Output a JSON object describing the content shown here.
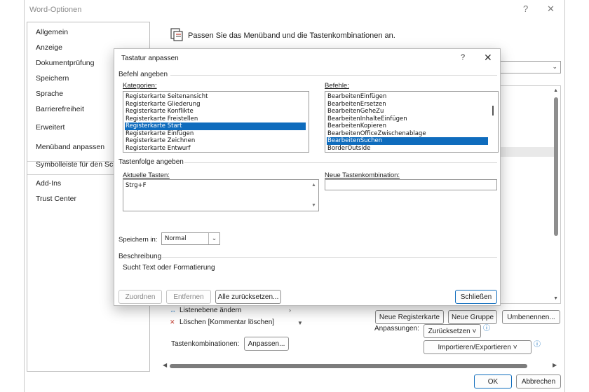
{
  "window": {
    "title": "Word-Optionen",
    "help_glyph": "?",
    "close_glyph": "✕"
  },
  "nav": {
    "items": [
      "Allgemein",
      "Anzeige",
      "Dokumentprüfung",
      "Speichern",
      "Sprache",
      "Barrierefreiheit",
      "Erweitert",
      "Menüband anpassen",
      "Symbolleiste für den Schn",
      "Add-Ins",
      "Trust Center"
    ]
  },
  "main": {
    "header": "Passen Sie das Menüband und die Tastenkombinationen an.",
    "list_items": [
      {
        "icon": "↔",
        "label": "Listenebene ändern"
      },
      {
        "icon": "✕",
        "label": "Löschen [Kommentar löschen]"
      }
    ],
    "new_tab_label": "Neue Registerkarte",
    "new_group_label": "Neue Gruppe",
    "rename_label": "Umbenennen...",
    "customizations_label": "Anpassungen:",
    "reset_label": "Zurücksetzen ˅",
    "import_export_label": "Importieren/Exportieren ˅",
    "shortcuts_label": "Tastenkombinationen:",
    "customize_label": "Anpassen...",
    "ok_label": "OK",
    "cancel_label": "Abbrechen"
  },
  "dialog": {
    "title": "Tastatur anpassen",
    "help_glyph": "?",
    "close_glyph": "✕",
    "section_commands": "Befehl angeben",
    "categories_label": "Kategorien:",
    "categories": [
      "Registerkarte Seitenansicht",
      "Registerkarte Gliederung",
      "Registerkarte Konflikte",
      "Registerkarte Freistellen",
      "Registerkarte Start",
      "Registerkarte Einfügen",
      "Registerkarte Zeichnen",
      "Registerkarte Entwurf"
    ],
    "categories_selected": 4,
    "commands_label": "Befehle:",
    "commands": [
      "BearbeitenEinfügen",
      "BearbeitenErsetzen",
      "BearbeitenGeheZu",
      "BearbeitenInhalteEinfügen",
      "BearbeitenKopieren",
      "BearbeitenOfficeZwischenablage",
      "BearbeitenSuchen",
      "BorderOutside"
    ],
    "commands_selected": 6,
    "section_keys": "Tastenfolge angeben",
    "current_keys_label": "Aktuelle Tasten:",
    "current_keys": "Strg+F",
    "new_shortcut_label": "Neue Tastenkombination:",
    "new_shortcut_value": "",
    "save_in_label": "Speichern in:",
    "save_in_value": "Normal",
    "section_description": "Beschreibung",
    "description": "Sucht Text oder Formatierung",
    "assign_label": "Zuordnen",
    "remove_label": "Entfernen",
    "reset_all_label": "Alle zurücksetzen...",
    "close_label": "Schließen"
  },
  "colors": {
    "accent": "#0f6cbd",
    "border": "#9a9a9a"
  }
}
